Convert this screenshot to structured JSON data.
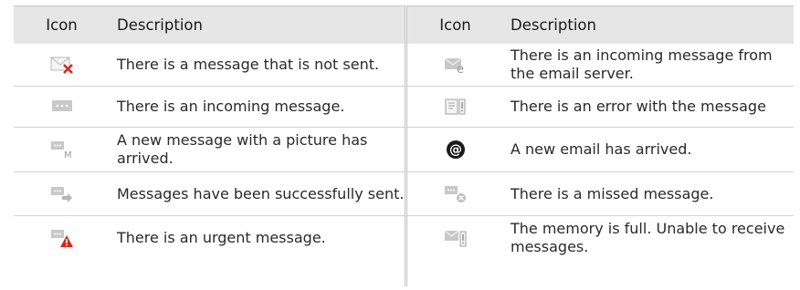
{
  "table": {
    "header": {
      "icon": "Icon",
      "description": "Description"
    },
    "left_rows": [
      {
        "icon": "unsent-message-icon",
        "text": "There is a message that is not sent."
      },
      {
        "icon": "incoming-message-icon",
        "text": "There is an incoming message."
      },
      {
        "icon": "picture-message-icon",
        "text": "A new message with a picture has arrived.",
        "icon_label": "M"
      },
      {
        "icon": "sent-message-icon",
        "text": "Messages have been successfully sent."
      },
      {
        "icon": "urgent-message-icon",
        "text": "There is an urgent message."
      }
    ],
    "right_rows": [
      {
        "icon": "email-server-message-icon",
        "text": "There is an incoming message from the email server.",
        "icon_label": "e"
      },
      {
        "icon": "message-error-icon",
        "text": "There is an error with the message"
      },
      {
        "icon": "new-email-icon",
        "text": "A new email has arrived.",
        "icon_label": "@"
      },
      {
        "icon": "missed-message-icon",
        "text": "There is a missed message."
      },
      {
        "icon": "memory-full-icon",
        "text": "The memory is full. Unable to receive messages."
      }
    ]
  }
}
